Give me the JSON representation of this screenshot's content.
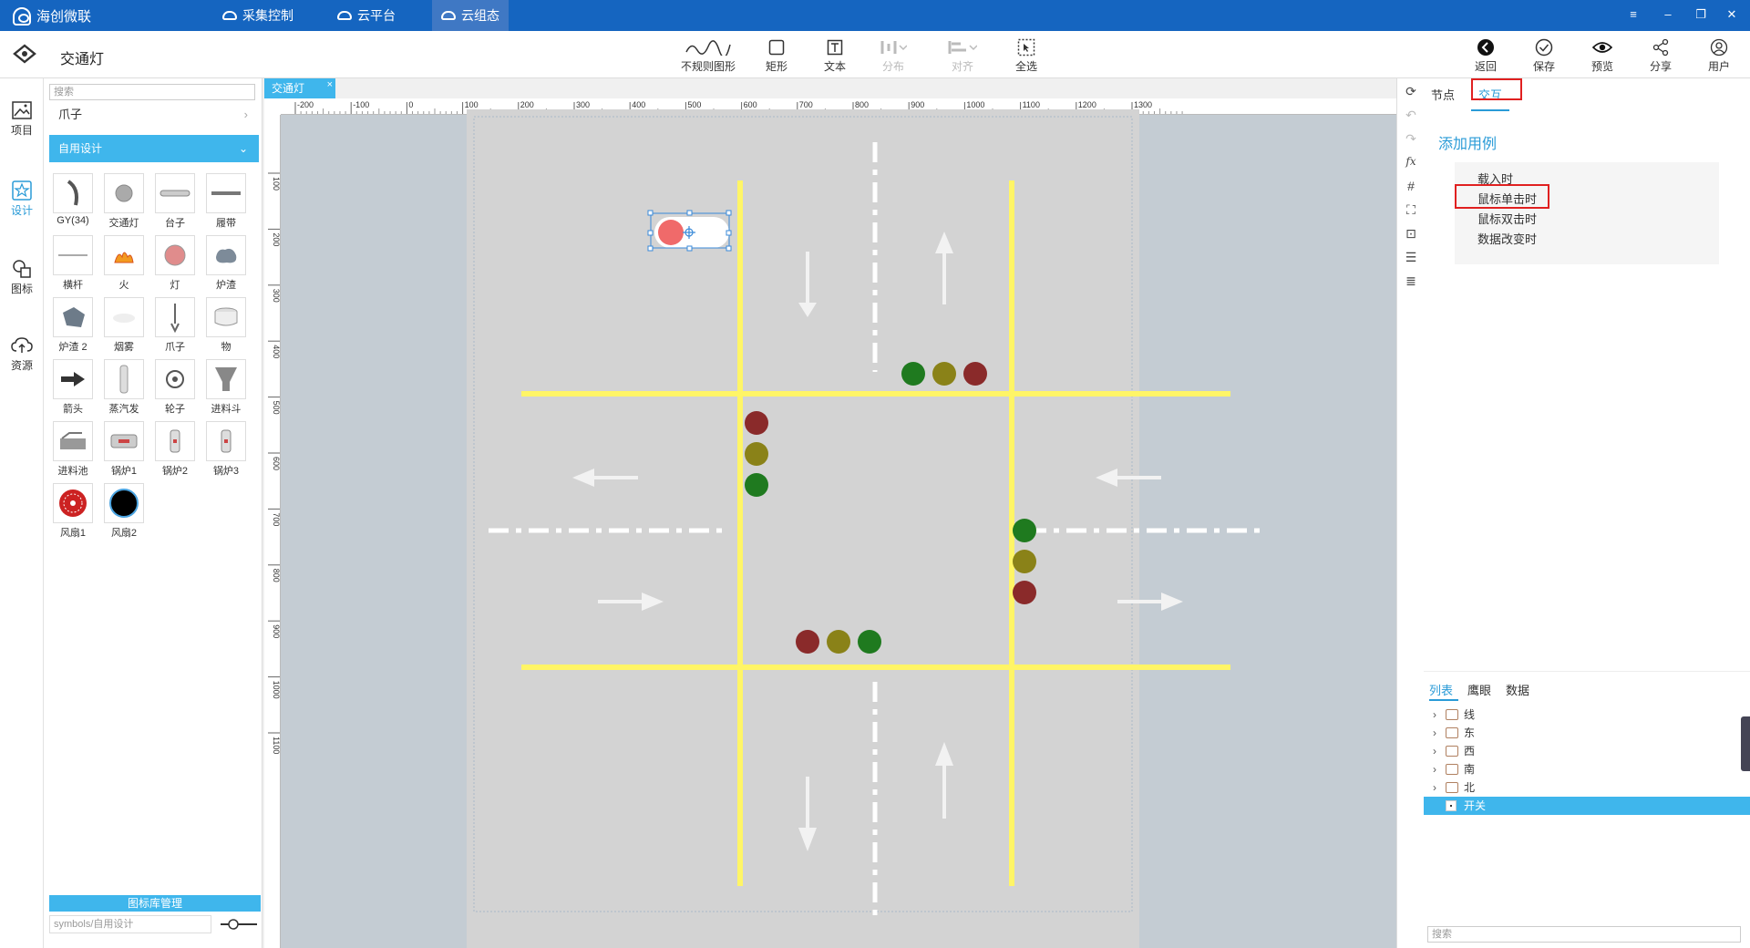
{
  "titlebar": {
    "app_name": "海创微联",
    "nav": [
      {
        "label": "采集控制",
        "active": false
      },
      {
        "label": "云平台",
        "active": false
      },
      {
        "label": "云组态",
        "active": true
      }
    ],
    "window_controls": [
      "menu-icon",
      "minimize-icon",
      "maximize-icon",
      "close-icon"
    ]
  },
  "toolbar": {
    "doc_title": "交通灯",
    "tools": [
      {
        "label": "不规则图形",
        "icon": "wave-icon",
        "enabled": true
      },
      {
        "label": "矩形",
        "icon": "rectangle-icon",
        "enabled": true
      },
      {
        "label": "文本",
        "icon": "text-icon",
        "enabled": true
      },
      {
        "label": "分布",
        "icon": "distribute-icon",
        "enabled": false
      },
      {
        "label": "对齐",
        "icon": "align-icon",
        "enabled": false
      },
      {
        "label": "全选",
        "icon": "select-all-icon",
        "enabled": true
      }
    ],
    "right_tools": [
      {
        "label": "返回",
        "icon": "back-icon"
      },
      {
        "label": "保存",
        "icon": "check-circle-icon"
      },
      {
        "label": "预览",
        "icon": "eye-icon"
      },
      {
        "label": "分享",
        "icon": "share-icon"
      },
      {
        "label": "用户",
        "icon": "user-icon"
      }
    ]
  },
  "rail": [
    {
      "label": "项目",
      "icon": "image-icon",
      "active": false
    },
    {
      "label": "设计",
      "icon": "star-icon",
      "active": true
    },
    {
      "label": "图标",
      "icon": "shapes-icon",
      "active": false
    },
    {
      "label": "资源",
      "icon": "cloud-upload-icon",
      "active": false
    }
  ],
  "library": {
    "search_placeholder": "搜索",
    "category": "爪子",
    "selected_group": "自用设计",
    "items": [
      "GY(34)",
      "交通灯",
      "台子",
      "履带",
      "横杆",
      "火",
      "灯",
      "炉渣",
      "炉渣 2",
      "烟雾",
      "爪子",
      "物",
      "箭头",
      "蒸汽发",
      "轮子",
      "进料斗",
      "进料池",
      "锅炉1",
      "锅炉2",
      "锅炉3",
      "风扇1",
      "风扇2"
    ],
    "manager_label": "图标库管理",
    "path_value": "symbols/自用设计"
  },
  "doc_tab": {
    "label": "交通灯"
  },
  "ruler": {
    "h_labels": [
      "-200",
      "-100",
      "0",
      "100",
      "200",
      "300",
      "400",
      "500",
      "600",
      "700",
      "800",
      "900",
      "1000",
      "1100",
      "1200",
      "1300"
    ],
    "v_labels": [
      "100",
      "200",
      "300",
      "400",
      "500",
      "600",
      "700",
      "800",
      "900",
      "1000",
      "1100"
    ]
  },
  "side_tools": [
    "refresh-icon",
    "undo-icon",
    "redo-icon",
    "fx-icon",
    "grid-icon",
    "fit-icon",
    "zoom-fit-icon",
    "align-left-icon",
    "indent-icon"
  ],
  "props": {
    "tabs": [
      {
        "label": "节点",
        "active": false
      },
      {
        "label": "交互",
        "active": true
      }
    ],
    "add_case": "添加用例",
    "cases": [
      "载入时",
      "鼠标单击时",
      "鼠标双击时",
      "数据改变时"
    ],
    "highlighted_case": "鼠标单击时"
  },
  "list": {
    "tabs": [
      {
        "label": "列表",
        "active": true
      },
      {
        "label": "鹰眼",
        "active": false
      },
      {
        "label": "数据",
        "active": false
      }
    ],
    "items": [
      {
        "label": "线",
        "type": "group",
        "selected": false
      },
      {
        "label": "东",
        "type": "group",
        "selected": false
      },
      {
        "label": "西",
        "type": "group",
        "selected": false
      },
      {
        "label": "南",
        "type": "group",
        "selected": false
      },
      {
        "label": "北",
        "type": "group",
        "selected": false
      },
      {
        "label": "开关",
        "type": "node",
        "selected": true
      }
    ],
    "search_placeholder": "搜索"
  },
  "colors": {
    "accent": "#3fb6ec",
    "titlebar": "#1565c0",
    "road_line": "#fff566",
    "light_red": "#8a2a2a",
    "light_yellow": "#8a8218",
    "light_green": "#1f7a1f",
    "canvas_bg": "#d3d3d3"
  }
}
